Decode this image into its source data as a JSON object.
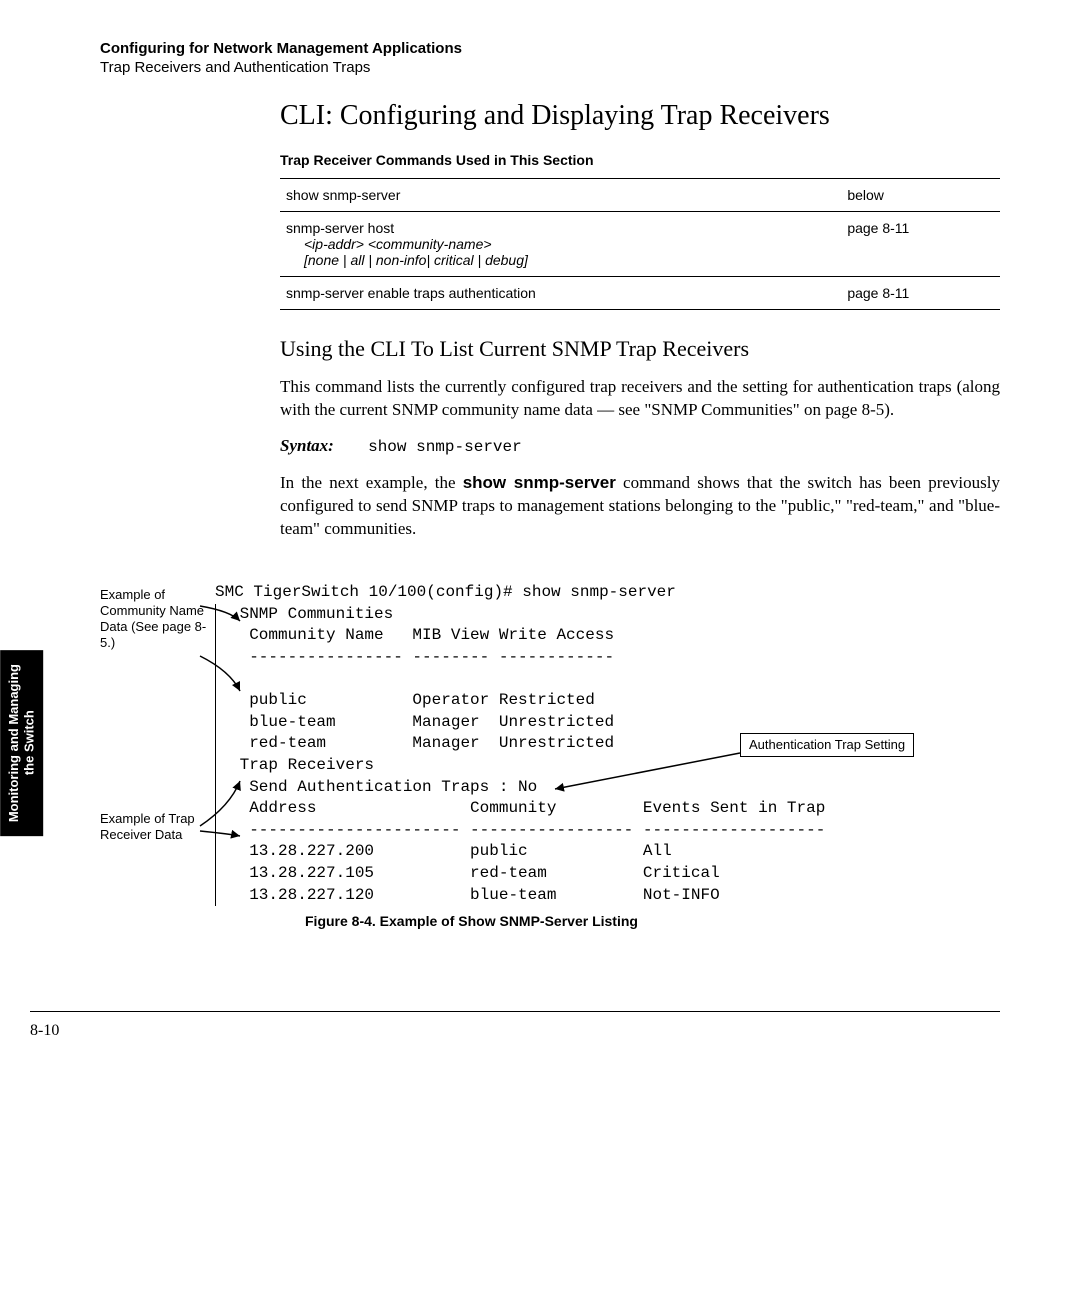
{
  "header": {
    "chapter": "Configuring for Network Management Applications",
    "sub": "Trap Receivers and Authentication Traps"
  },
  "sideTab": "Monitoring and Managing\nthe Switch",
  "title": "CLI: Configuring and Displaying Trap Receivers",
  "tableCaption": "Trap Receiver Commands Used in This Section",
  "table": {
    "rows": [
      {
        "cmd": "show snmp-server",
        "sub1": "",
        "sub2": "",
        "ref": "below"
      },
      {
        "cmd": "snmp-server host",
        "sub1": "<ip-addr> <community-name>",
        "sub2": "[none | all | non-info| critical | debug]",
        "ref": "page 8-11"
      },
      {
        "cmd": "snmp-server enable traps authentication",
        "sub1": "",
        "sub2": "",
        "ref": "page 8-11"
      }
    ]
  },
  "subsection": "Using the CLI To List Current SNMP Trap Receivers",
  "para1": "This command lists the currently configured trap receivers and the setting for authentication traps (along with the current SNMP community name data — see \"SNMP Communities\" on page 8-5).",
  "syntaxLabel": "Syntax:",
  "syntaxCmd": "show snmp-server",
  "para2_pre": "In the next example, the ",
  "para2_bold": "show snmp-server",
  "para2_post": " command shows that the switch has been previously configured to send SNMP traps to management stations belonging to the \"public,\" \"red-team,\" and \"blue-team\" communities.",
  "figure": {
    "prompt": "SMC TigerSwitch 10/100(config)# show snmp-server",
    "communitiesHeader": " SNMP Communities",
    "communitiesCols": "  Community Name   MIB View Write Access",
    "communitiesSep": "  ---------------- -------- ------------",
    "communityRows": [
      "  public           Operator Restricted",
      "  blue-team        Manager  Unrestricted",
      "  red-team         Manager  Unrestricted"
    ],
    "trapHeader": " Trap Receivers",
    "trapAuthLine": "  Send Authentication Traps : No",
    "trapCols": "  Address                Community         Events Sent in Trap",
    "trapSep": "  ---------------------- ----------------- -------------------",
    "trapRows": [
      "  13.28.227.200          public            All",
      "  13.28.227.105          red-team          Critical",
      "  13.28.227.120          blue-team         Not-INFO"
    ],
    "ann1": "Example of Community Name Data (See page 8-5.)",
    "ann2": "Example of Trap Receiver Data",
    "ann3": "Authentication Trap Setting",
    "caption": "Figure 8-4.  Example of Show SNMP-Server Listing"
  },
  "pageNumber": "8-10"
}
